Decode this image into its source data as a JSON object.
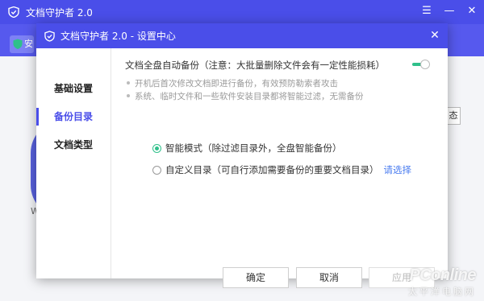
{
  "app": {
    "title": "文档守护者 2.0",
    "banner_tag": "安"
  },
  "background": {
    "partial_letter": "W",
    "right_button_label": "态"
  },
  "dialog": {
    "title": "文档守护者 2.0 - 设置中心",
    "sidebar": [
      {
        "label": "基础设置",
        "active": false
      },
      {
        "label": "备份目录",
        "active": true
      },
      {
        "label": "文档类型",
        "active": false
      }
    ],
    "option_title": "文档全盘自动备份（注意：大批量删除文件会有一定性能损耗）",
    "toggle_on": true,
    "notes": [
      "开机后首次修改文档即进行备份，有效预防勒索者攻击",
      "系统、临时文件和一些软件安装目录都将智能过滤，无需备份"
    ],
    "modes": [
      {
        "label": "智能模式（除过滤目录外，全盘智能备份）",
        "checked": true
      },
      {
        "label": "自定义目录（可自行添加需要备份的重要文档目录）",
        "checked": false,
        "link": "请选择"
      }
    ],
    "buttons": {
      "ok": "确定",
      "cancel": "取消",
      "apply": "应用"
    }
  },
  "watermark": {
    "brand": "PConline",
    "sub": "太平洋电脑网"
  },
  "colors": {
    "primary": "#4a4ee9",
    "toggle_on": "#2fc08a",
    "link": "#4a7cf0"
  }
}
